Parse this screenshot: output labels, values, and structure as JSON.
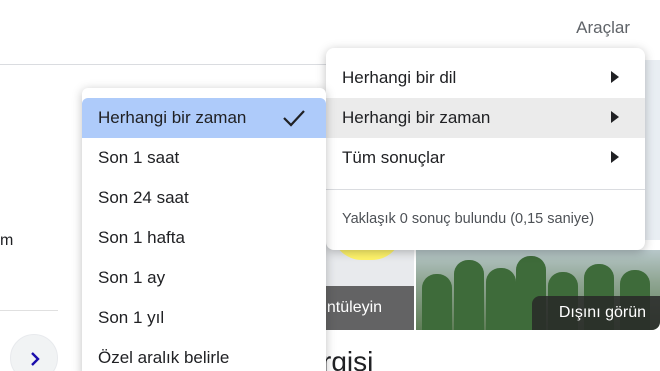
{
  "header": {
    "tools_label": "Araçlar"
  },
  "background": {
    "left_text": "m",
    "tile_a_label": "üntüleyin",
    "tile_b_label": "Dışını görün",
    "heading_fragment": "rgisi",
    "colors": {
      "tile_overlay": "#464646",
      "yellow": "#fff46a"
    }
  },
  "tools_menu": {
    "items": [
      {
        "label": "Herhangi bir dil",
        "icon": "arrow-right-icon"
      },
      {
        "label": "Herhangi bir zaman",
        "icon": "arrow-right-icon",
        "active": true
      },
      {
        "label": "Tüm sonuçlar",
        "icon": "arrow-right-icon"
      }
    ],
    "result_stats": "Yaklaşık 0 sonuç bulundu (0,15 saniye)"
  },
  "time_submenu": {
    "items": [
      {
        "label": "Herhangi bir zaman",
        "selected": true,
        "icon": "check-icon"
      },
      {
        "label": "Son 1 saat"
      },
      {
        "label": "Son 24 saat"
      },
      {
        "label": "Son 1 hafta"
      },
      {
        "label": "Son 1 ay"
      },
      {
        "label": "Son 1 yıl"
      },
      {
        "label": "Özel aralık belirle"
      }
    ],
    "selected_color": "#aecbfa"
  }
}
